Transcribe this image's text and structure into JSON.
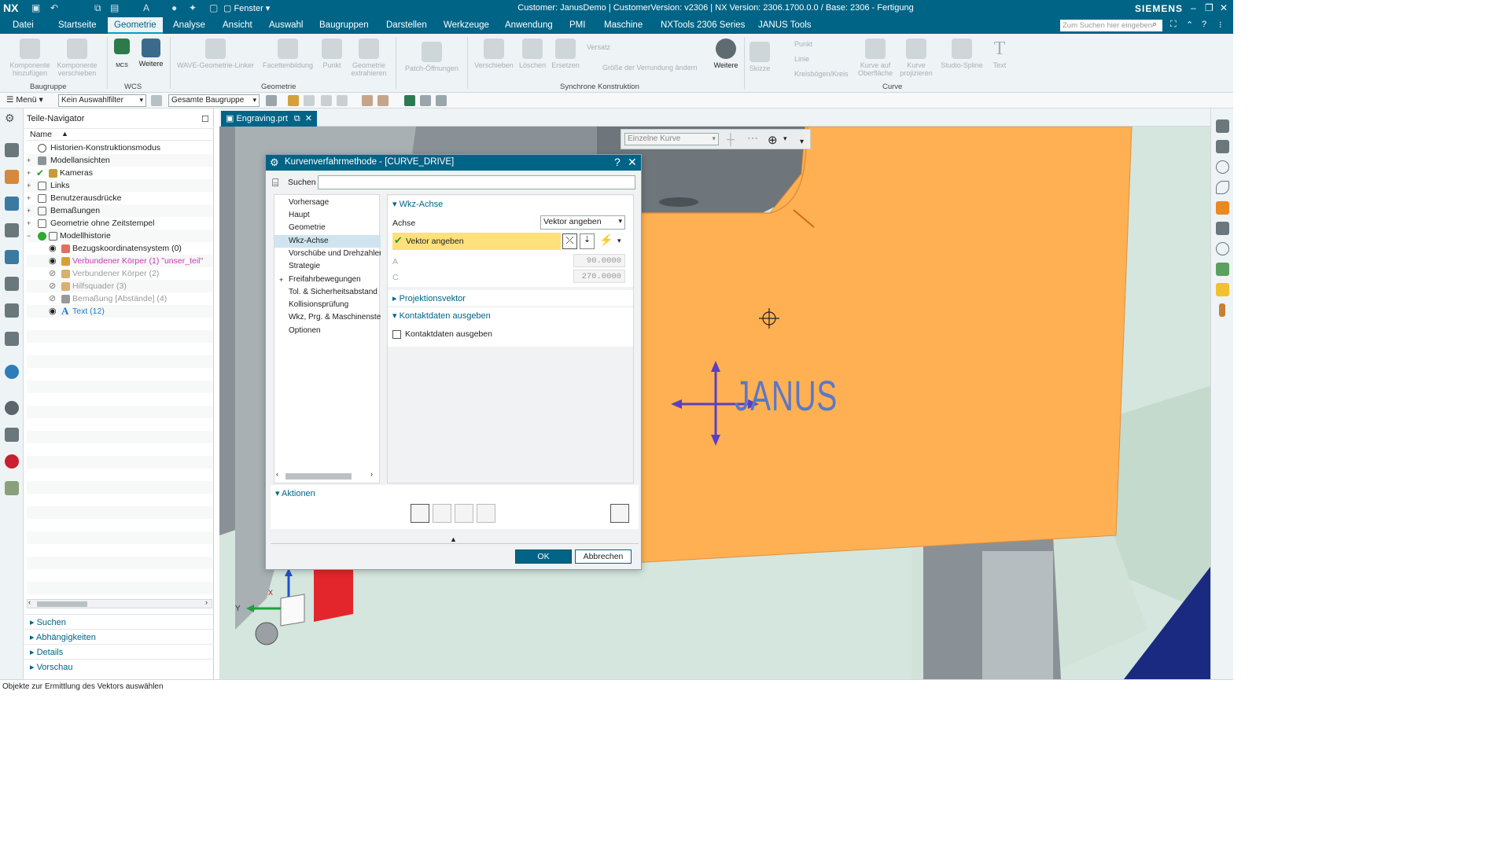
{
  "titlebar": {
    "app": "NX",
    "window_menu": "Fenster",
    "title": "Customer: JanusDemo | CustomerVersion: v2306 | NX Version: 2306.1700.0.0 / Base: 2306 - Fertigung",
    "brand": "SIEMENS"
  },
  "menubar": {
    "tabs": [
      "Datei",
      "Startseite",
      "Geometrie",
      "Analyse",
      "Ansicht",
      "Auswahl",
      "Baugruppen",
      "Darstellen",
      "Werkzeuge",
      "Anwendung",
      "PMI",
      "Maschine",
      "NXTools 2306 Series",
      "JANUS Tools"
    ],
    "active_tab": "Geometrie",
    "search_placeholder": "Zum Suchen hier eingeben"
  },
  "ribbon": {
    "komponente_hinzufuegen": "Komponente hinzufügen",
    "komponente_verschieben": "Komponente verschieben",
    "mcs": "MCS",
    "weitere_wcs": "Weitere",
    "wave": "WAVE-Geometrie-Linker",
    "facettenbildung": "Facettenbildung",
    "punkt": "Punkt",
    "geometrie_extrahieren": "Geometrie extrahieren",
    "patch": "Patch-Öffnungen",
    "verschieben": "Verschieben",
    "loeschen": "Löschen",
    "ersetzen": "Ersetzen",
    "versatz": "Versatz",
    "groesse": "Größe der Verrundung ändern",
    "weitere_sync": "Weitere",
    "skizze": "Skizze",
    "punkt2": "Punkt",
    "linie": "Linie",
    "kreisboegen": "Kreisbögen/Kreis",
    "kurve_oberflaeche": "Kurve auf Oberfläche",
    "kurve_projizieren": "Kurve projizieren",
    "studio_spline": "Studio-Spline",
    "text": "Text",
    "groups": {
      "baugruppe": "Baugruppe",
      "wcs": "WCS",
      "geometrie": "Geometrie",
      "synchrone": "Synchrone Konstruktion",
      "curve": "Curve"
    }
  },
  "toolbar2": {
    "menu": "Menü",
    "filter": "Kein Auswahlfilter",
    "scope": "Gesamte Baugruppe"
  },
  "navigator": {
    "title": "Teile-Navigator",
    "column": "Name",
    "rows": [
      {
        "label": "Historien-Konstruktionsmodus",
        "color": "#222222"
      },
      {
        "label": "Modellansichten",
        "color": "#222222"
      },
      {
        "label": "Kameras",
        "color": "#222222"
      },
      {
        "label": "Links",
        "color": "#222222"
      },
      {
        "label": "Benutzerausdrücke",
        "color": "#222222"
      },
      {
        "label": "Bemaßungen",
        "color": "#222222"
      },
      {
        "label": "Geometrie ohne Zeitstempel",
        "color": "#222222"
      },
      {
        "label": "Modellhistorie",
        "color": "#222222"
      },
      {
        "label": "Bezugskoordinatensystem (0)",
        "color": "#222222"
      },
      {
        "label": "Verbundener Körper (1) \"unser_teil\"",
        "color": "#c83cb4"
      },
      {
        "label": "Verbundener Körper (2)",
        "color": "#9a9a9a"
      },
      {
        "label": "Hilfsquader (3)",
        "color": "#9a9a9a"
      },
      {
        "label": "Bemaßung [Abstände] (4)",
        "color": "#9a9a9a"
      },
      {
        "label": "Text (12)",
        "color": "#1e78d2"
      }
    ],
    "panels": [
      "Suchen",
      "Abhängigkeiten",
      "Details",
      "Vorschau"
    ]
  },
  "viewport": {
    "file_tab": "Engraving.prt",
    "curve_filter": "Einzelne Kurve",
    "engraving_text": "JANUS",
    "axis_y": "Y",
    "axis_x": "X",
    "part_color": "#ffb053",
    "fixture_color": "#d4e6dd",
    "dark_color": "#1a2a80"
  },
  "dialog": {
    "title": "Kurvenverfahrmethode - [CURVE_DRIVE]",
    "help": "?",
    "search_label": "Suchen",
    "tree": [
      "Vorhersage",
      "Haupt",
      "Geometrie",
      "Wkz-Achse",
      "Vorschübe und Drehzahlen",
      "Strategie",
      "Freifahrbewegungen",
      "Tol. & Sicherheitsabstand",
      "Kollisionsprüfung",
      "Wkz, Prg. & Maschinensteuerung",
      "Optionen"
    ],
    "selected_tree": "Wkz-Achse",
    "section_wkz": "Wkz-Achse",
    "achse_label": "Achse",
    "achse_value": "Vektor angeben",
    "vektor_label": "Vektor angeben",
    "a_label": "A",
    "a_value": "90.0000",
    "c_label": "C",
    "c_value": "270.0000",
    "section_projektion": "Projektionsvektor",
    "section_kontakt": "Kontaktdaten ausgeben",
    "kontakt_checkbox": "Kontaktdaten ausgeben",
    "aktionen": "Aktionen",
    "ok": "OK",
    "abbrechen": "Abbrechen"
  },
  "status": "Objekte zur Ermittlung des Vektors auswählen"
}
